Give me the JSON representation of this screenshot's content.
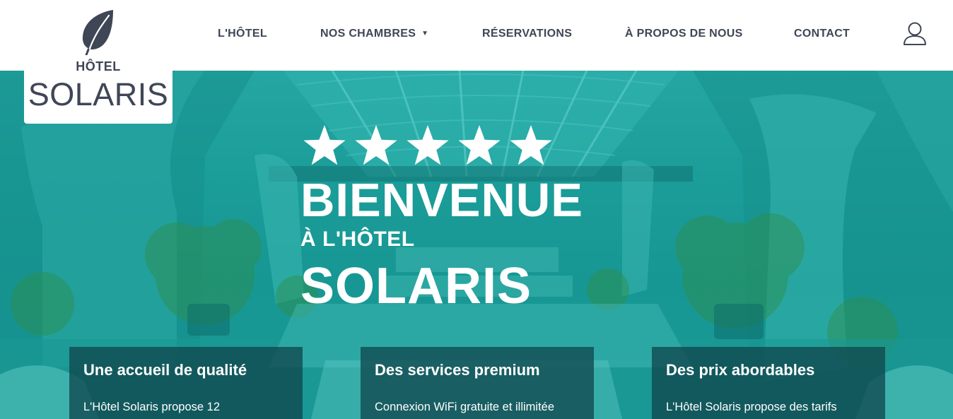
{
  "brand": {
    "small": "HÔTEL",
    "name": "SOLARIS",
    "leaf_icon": "leaf-icon",
    "color": "#3f4656"
  },
  "nav": {
    "items": [
      {
        "label": "L'HÔTEL"
      },
      {
        "label": "NOS CHAMBRES",
        "caret": "▼"
      },
      {
        "label": "RÉSERVATIONS"
      },
      {
        "label": "À PROPOS DE NOUS"
      },
      {
        "label": "CONTACT"
      }
    ],
    "user_icon": "user-icon"
  },
  "hero": {
    "stars": 5,
    "line1": "BIENVENUE",
    "line2": "À L'HÔTEL",
    "line3": "SOLARIS",
    "accent": "#1c9c98"
  },
  "features": [
    {
      "title": "Une accueil de qualité",
      "text": "L'Hôtel Solaris propose 12"
    },
    {
      "title": "Des services premium",
      "text": "Connexion WiFi gratuite et illimitée"
    },
    {
      "title": "Des prix abordables",
      "text": "L'Hôtel Solaris propose des tarifs"
    }
  ]
}
